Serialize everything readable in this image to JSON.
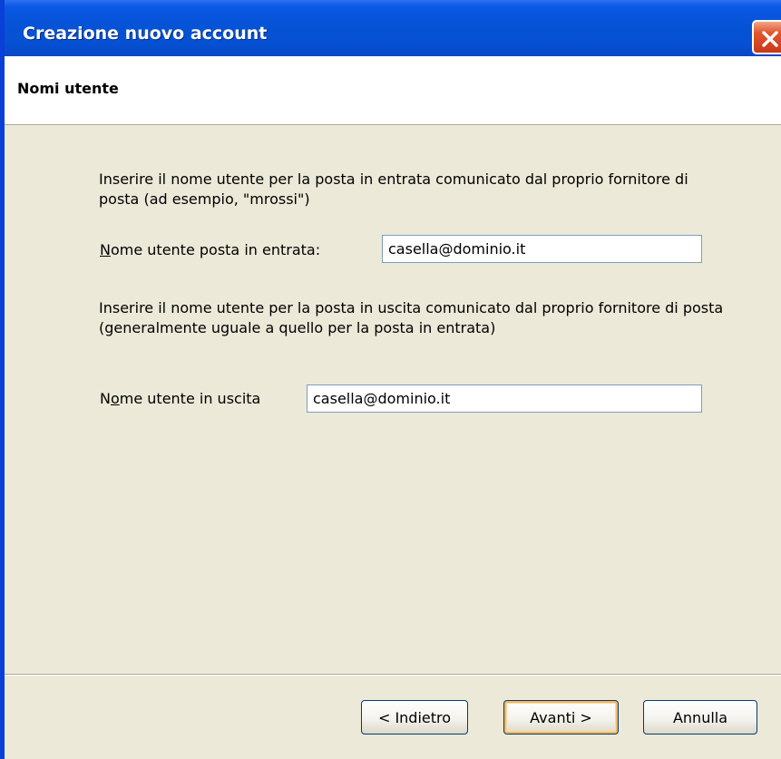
{
  "window": {
    "title": "Creazione nuovo account",
    "close_icon": "close-icon"
  },
  "header": {
    "title": "Nomi utente"
  },
  "incoming": {
    "description": "Inserire il nome utente per la posta in entrata comunicato dal proprio fornitore di posta (ad esempio, \"mrossi\")",
    "label_accel": "N",
    "label_rest": "ome utente posta in entrata:",
    "value": "casella@dominio.it"
  },
  "outgoing": {
    "description": "Inserire il nome utente per la posta in uscita comunicato dal proprio fornitore di posta (generalmente uguale a quello per la posta in entrata)",
    "label_pre": "N",
    "label_accel": "o",
    "label_rest": "me utente in uscita",
    "value": "casella@dominio.it"
  },
  "buttons": {
    "back": "< Indietro",
    "next": "Avanti >",
    "cancel": "Annulla"
  },
  "colors": {
    "titlebar": "#0653D6",
    "dialog_bg": "#ECE9D8",
    "close": "#E2572E"
  }
}
